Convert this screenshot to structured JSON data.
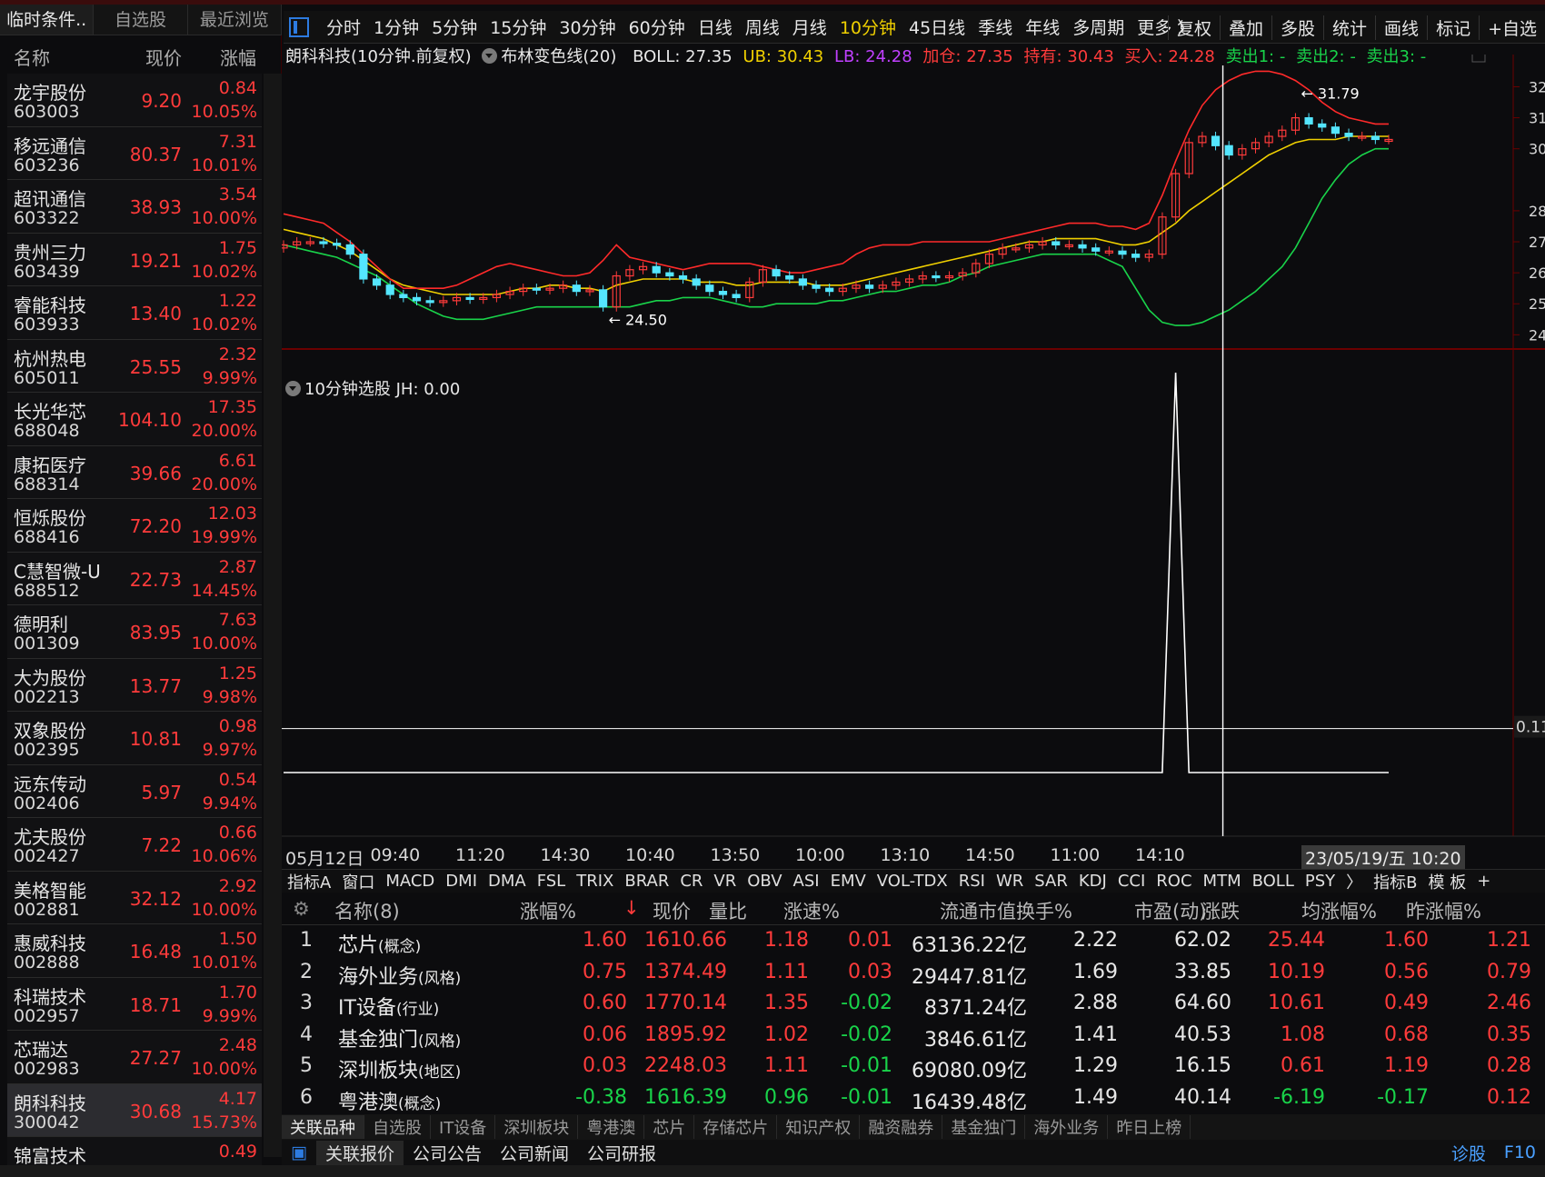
{
  "left_panel": {
    "tabs": [
      "临时条件..",
      "自选股",
      "最近浏览"
    ],
    "header": {
      "name": "名称",
      "price": "现价",
      "change": "涨幅"
    },
    "stocks": [
      {
        "name": "龙宇股份",
        "code": "603003",
        "price": "9.20",
        "change": "0.84",
        "pct": "10.05%"
      },
      {
        "name": "移远通信",
        "code": "603236",
        "price": "80.37",
        "change": "7.31",
        "pct": "10.01%"
      },
      {
        "name": "超讯通信",
        "code": "603322",
        "price": "38.93",
        "change": "3.54",
        "pct": "10.00%"
      },
      {
        "name": "贵州三力",
        "code": "603439",
        "price": "19.21",
        "change": "1.75",
        "pct": "10.02%"
      },
      {
        "name": "睿能科技",
        "code": "603933",
        "price": "13.40",
        "change": "1.22",
        "pct": "10.02%"
      },
      {
        "name": "杭州热电",
        "code": "605011",
        "price": "25.55",
        "change": "2.32",
        "pct": "9.99%"
      },
      {
        "name": "长光华芯",
        "code": "688048",
        "price": "104.10",
        "change": "17.35",
        "pct": "20.00%"
      },
      {
        "name": "康拓医疗",
        "code": "688314",
        "price": "39.66",
        "change": "6.61",
        "pct": "20.00%"
      },
      {
        "name": "恒烁股份",
        "code": "688416",
        "price": "72.20",
        "change": "12.03",
        "pct": "19.99%"
      },
      {
        "name": "C慧智微-U",
        "code": "688512",
        "price": "22.73",
        "change": "2.87",
        "pct": "14.45%"
      },
      {
        "name": "德明利",
        "code": "001309",
        "price": "83.95",
        "change": "7.63",
        "pct": "10.00%"
      },
      {
        "name": "大为股份",
        "code": "002213",
        "price": "13.77",
        "change": "1.25",
        "pct": "9.98%"
      },
      {
        "name": "双象股份",
        "code": "002395",
        "price": "10.81",
        "change": "0.98",
        "pct": "9.97%"
      },
      {
        "name": "远东传动",
        "code": "002406",
        "price": "5.97",
        "change": "0.54",
        "pct": "9.94%"
      },
      {
        "name": "尤夫股份",
        "code": "002427",
        "price": "7.22",
        "change": "0.66",
        "pct": "10.06%"
      },
      {
        "name": "美格智能",
        "code": "002881",
        "price": "32.12",
        "change": "2.92",
        "pct": "10.00%"
      },
      {
        "name": "惠威科技",
        "code": "002888",
        "price": "16.48",
        "change": "1.50",
        "pct": "10.01%"
      },
      {
        "name": "科瑞技术",
        "code": "002957",
        "price": "18.71",
        "change": "1.70",
        "pct": "9.99%"
      },
      {
        "name": "芯瑞达",
        "code": "002983",
        "price": "27.27",
        "change": "2.48",
        "pct": "10.00%"
      },
      {
        "name": "朗科科技",
        "code": "300042",
        "price": "30.68",
        "change": "4.17",
        "pct": "15.73%"
      },
      {
        "name": "锦富技术",
        "code": "",
        "price": "",
        "change": "0.49",
        "pct": ""
      }
    ]
  },
  "toolbar": {
    "periods": [
      "分时",
      "1分钟",
      "5分钟",
      "15分钟",
      "30分钟",
      "60分钟",
      "日线",
      "周线",
      "月线",
      "10分钟",
      "45日线",
      "季线",
      "年线",
      "多周期",
      "更多 〉"
    ],
    "active_period": "10分钟",
    "right": [
      "复权",
      "叠加",
      "多股",
      "统计",
      "画线",
      "标记",
      "+自选"
    ]
  },
  "info_line": {
    "title": "朗科科技(10分钟.前复权)",
    "indicator": "布林变色线(20)",
    "boll": "BOLL: 27.35",
    "ub": "UB: 30.43",
    "lb": "LB: 24.28",
    "add": "加仓: 27.35",
    "hold": "持有: 30.43",
    "buy": "买入: 24.28",
    "sell1": "卖出1: -",
    "sell2": "卖出2: -",
    "sell3": "卖出3: -"
  },
  "indicator2_title": "10分钟选股  JH: 0.00",
  "colors": {
    "up": "#ff3b3b",
    "down": "#54e6ff",
    "boll_mid": "#f0d000",
    "boll_upper_band": "#ff2a2a",
    "boll_lower_band": "#19d34a",
    "signal": "#ffffff"
  },
  "chart_data": [
    {
      "type": "candlestick",
      "name": "朗科科技 10分钟 BOLL",
      "ylim": [
        23.6,
        32.6
      ],
      "y_ticks": [
        "32",
        "31",
        "30",
        "28",
        "27",
        "26",
        "25",
        "24"
      ],
      "annotations": [
        {
          "text": "31.79",
          "near": "high"
        },
        {
          "text": "24.50",
          "near": "low"
        }
      ],
      "close": [
        26.9,
        27.0,
        27.0,
        26.95,
        26.9,
        26.6,
        25.8,
        25.6,
        25.3,
        25.2,
        25.1,
        25.05,
        25.1,
        25.2,
        25.15,
        25.2,
        25.3,
        25.4,
        25.5,
        25.45,
        25.5,
        25.6,
        25.4,
        25.45,
        24.9,
        25.9,
        26.1,
        26.2,
        26.0,
        25.9,
        25.8,
        25.6,
        25.4,
        25.3,
        25.2,
        25.7,
        26.1,
        25.9,
        25.8,
        25.6,
        25.5,
        25.4,
        25.5,
        25.6,
        25.5,
        25.6,
        25.7,
        25.8,
        25.9,
        25.85,
        25.9,
        26.0,
        26.3,
        26.6,
        26.8,
        26.8,
        26.9,
        27.0,
        26.9,
        26.9,
        26.8,
        26.7,
        26.7,
        26.6,
        26.5,
        26.6,
        27.8,
        29.2,
        30.2,
        30.4,
        30.1,
        29.8,
        30.0,
        30.2,
        30.4,
        30.6,
        31.0,
        30.8,
        30.7,
        30.5,
        30.4,
        30.4,
        30.3,
        30.3
      ],
      "upper": [
        27.9,
        27.8,
        27.7,
        27.6,
        27.3,
        27.0,
        26.6,
        26.2,
        25.8,
        25.5,
        25.5,
        25.5,
        25.5,
        25.6,
        25.8,
        26.0,
        26.2,
        26.3,
        26.2,
        26.1,
        26.0,
        25.9,
        25.9,
        26.0,
        26.4,
        26.9,
        26.5,
        26.4,
        26.3,
        26.2,
        26.1,
        26.2,
        26.3,
        26.3,
        26.3,
        26.3,
        26.2,
        26.1,
        26.0,
        26.0,
        26.1,
        26.2,
        26.3,
        26.6,
        26.8,
        26.9,
        26.9,
        26.9,
        27.0,
        27.0,
        27.0,
        27.0,
        27.0,
        27.0,
        27.1,
        27.2,
        27.3,
        27.4,
        27.5,
        27.6,
        27.6,
        27.6,
        27.5,
        27.5,
        27.4,
        27.6,
        28.5,
        29.6,
        30.6,
        31.4,
        31.9,
        32.2,
        32.4,
        32.5,
        32.5,
        32.4,
        32.2,
        31.9,
        31.5,
        31.2,
        31.0,
        30.9,
        30.8,
        30.8
      ],
      "mid": [
        27.4,
        27.3,
        27.2,
        27.1,
        26.9,
        26.7,
        26.4,
        26.1,
        25.8,
        25.6,
        25.5,
        25.4,
        25.3,
        25.3,
        25.3,
        25.3,
        25.3,
        25.4,
        25.5,
        25.5,
        25.6,
        25.6,
        25.5,
        25.5,
        25.4,
        25.6,
        25.7,
        25.8,
        25.8,
        25.8,
        25.8,
        25.7,
        25.7,
        25.7,
        25.6,
        25.6,
        25.7,
        25.7,
        25.7,
        25.7,
        25.6,
        25.6,
        25.6,
        25.7,
        25.8,
        25.9,
        26.0,
        26.1,
        26.2,
        26.3,
        26.4,
        26.5,
        26.6,
        26.7,
        26.8,
        26.9,
        27.0,
        27.0,
        27.1,
        27.1,
        27.1,
        27.1,
        27.0,
        26.9,
        26.9,
        27.0,
        27.3,
        27.6,
        28.0,
        28.3,
        28.6,
        28.9,
        29.2,
        29.5,
        29.8,
        30.0,
        30.2,
        30.3,
        30.3,
        30.3,
        30.4,
        30.4,
        30.4,
        30.4
      ],
      "lower": [
        26.9,
        26.8,
        26.7,
        26.6,
        26.5,
        26.3,
        26.1,
        25.9,
        25.6,
        25.3,
        25.0,
        24.8,
        24.6,
        24.5,
        24.5,
        24.5,
        24.6,
        24.7,
        24.8,
        24.9,
        24.9,
        24.9,
        24.9,
        24.9,
        24.9,
        24.9,
        24.9,
        25.0,
        25.1,
        25.1,
        25.2,
        25.2,
        25.2,
        25.1,
        25.0,
        24.9,
        24.9,
        25.0,
        25.0,
        25.0,
        25.0,
        25.1,
        25.1,
        25.2,
        25.3,
        25.4,
        25.4,
        25.5,
        25.6,
        25.6,
        25.7,
        25.9,
        26.0,
        26.2,
        26.3,
        26.4,
        26.5,
        26.6,
        26.6,
        26.6,
        26.6,
        26.6,
        26.4,
        26.2,
        25.5,
        24.8,
        24.4,
        24.3,
        24.3,
        24.4,
        24.6,
        24.8,
        25.1,
        25.4,
        25.8,
        26.2,
        26.8,
        27.6,
        28.4,
        29.0,
        29.5,
        29.8,
        30.0,
        30.0
      ]
    },
    {
      "type": "line",
      "name": "10分钟选股 JH",
      "ylim": [
        0,
        1
      ],
      "y_ticks": [
        "0.11"
      ],
      "values": [
        0,
        0,
        0,
        0,
        0,
        0,
        0,
        0,
        0,
        0,
        0,
        0,
        0,
        0,
        0,
        0,
        0,
        0,
        0,
        0,
        0,
        0,
        0,
        0,
        0,
        0,
        0,
        0,
        0,
        0,
        0,
        0,
        0,
        0,
        0,
        0,
        0,
        0,
        0,
        0,
        0,
        0,
        0,
        0,
        0,
        0,
        0,
        0,
        0,
        0,
        0,
        0,
        0,
        0,
        0,
        0,
        0,
        0,
        0,
        0,
        0,
        0,
        0,
        0,
        0,
        0,
        0,
        1,
        0,
        0,
        0,
        0,
        0,
        0,
        0,
        0,
        0,
        0,
        0,
        0,
        0,
        0,
        0,
        0
      ],
      "x_labels": [
        "05月12日",
        "09:40",
        "11:20",
        "14:30",
        "10:40",
        "13:50",
        "10:00",
        "13:10",
        "14:50",
        "11:00",
        "14:10"
      ],
      "cursor_label": "23/05/19/五 10:20"
    }
  ],
  "indicator_tabs": [
    "指标A",
    "窗口",
    "MACD",
    "DMI",
    "DMA",
    "FSL",
    "TRIX",
    "BRAR",
    "CR",
    "VR",
    "OBV",
    "ASI",
    "EMV",
    "VOL-TDX",
    "RSI",
    "WR",
    "SAR",
    "KDJ",
    "CCI",
    "ROC",
    "MTM",
    "BOLL",
    "PSY",
    "〉",
    "指标B",
    "模 板",
    "+"
  ],
  "table": {
    "headers": [
      "名称(8)",
      "涨幅%",
      "现价",
      "量比",
      "涨速%",
      "流通市值",
      "换手%",
      "市盈(动)",
      "涨跌",
      "均涨幅%",
      "昨涨幅%"
    ],
    "rows": [
      {
        "idx": "1",
        "name": "芯片",
        "tag": "(概念)",
        "chg": "1.60",
        "price": "1610.66",
        "vr": "1.18",
        "spd": "0.01",
        "cap": "63136.22亿",
        "turn": "2.22",
        "pe": "62.02",
        "diff": "25.44",
        "avg": "1.60",
        "prev": "1.21"
      },
      {
        "idx": "2",
        "name": "海外业务",
        "tag": "(风格)",
        "chg": "0.75",
        "price": "1374.49",
        "vr": "1.11",
        "spd": "0.03",
        "cap": "29447.81亿",
        "turn": "1.69",
        "pe": "33.85",
        "diff": "10.19",
        "avg": "0.56",
        "prev": "0.79"
      },
      {
        "idx": "3",
        "name": "IT设备",
        "tag": "(行业)",
        "chg": "0.60",
        "price": "1770.14",
        "vr": "1.35",
        "spd": "-0.02",
        "cap": "8371.24亿",
        "turn": "2.88",
        "pe": "64.60",
        "diff": "10.61",
        "avg": "0.49",
        "prev": "2.46"
      },
      {
        "idx": "4",
        "name": "基金独门",
        "tag": "(风格)",
        "chg": "0.06",
        "price": "1895.92",
        "vr": "1.02",
        "spd": "-0.02",
        "cap": "3846.61亿",
        "turn": "1.41",
        "pe": "40.53",
        "diff": "1.08",
        "avg": "0.68",
        "prev": "0.35"
      },
      {
        "idx": "5",
        "name": "深圳板块",
        "tag": "(地区)",
        "chg": "0.03",
        "price": "2248.03",
        "vr": "1.11",
        "spd": "-0.01",
        "cap": "69080.09亿",
        "turn": "1.29",
        "pe": "16.15",
        "diff": "0.61",
        "avg": "1.19",
        "prev": "0.28"
      },
      {
        "idx": "6",
        "name": "粤港澳",
        "tag": "(概念)",
        "chg": "-0.38",
        "price": "1616.39",
        "vr": "0.96",
        "spd": "-0.01",
        "cap": "16439.48亿",
        "turn": "1.49",
        "pe": "40.14",
        "diff": "-6.19",
        "avg": "-0.17",
        "prev": "0.12"
      }
    ]
  },
  "bottom_tabs": [
    "关联品种",
    "自选股",
    "IT设备",
    "深圳板块",
    "粤港澳",
    "芯片",
    "存储芯片",
    "知识产权",
    "融资融券",
    "基金独门",
    "海外业务",
    "昨日上榜"
  ],
  "sub_tabs": [
    "关联报价",
    "公司公告",
    "公司新闻",
    "公司研报"
  ],
  "sub_right": [
    "诊股",
    "F10"
  ]
}
